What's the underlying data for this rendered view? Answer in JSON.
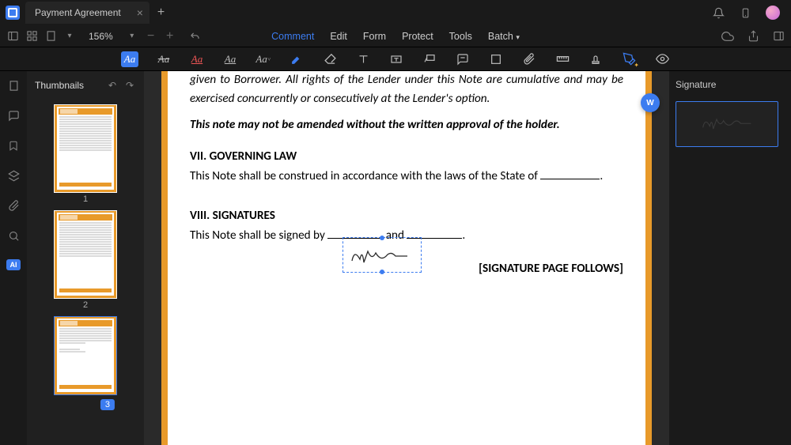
{
  "tab": {
    "title": "Payment Agreement"
  },
  "zoom": "156%",
  "menu": {
    "comment": "Comment",
    "edit": "Edit",
    "form": "Form",
    "protect": "Protect",
    "tools": "Tools",
    "batch": "Batch"
  },
  "thumbnails": {
    "title": "Thumbnails",
    "pages": [
      "1",
      "2",
      "3"
    ]
  },
  "doc": {
    "p1": "given to Borrower. All rights of the Lender under this Note are cumulative and may be exercised concurrently or consecutively at the Lender's option.",
    "p2": "This note may not be amended without the written approval of the holder.",
    "s7_title": "VII. GOVERNING LAW",
    "s7_body_a": "This Note shall be construed in accordance with the laws of the State of ",
    "s7_body_b": ".",
    "s8_title": "VIII. SIGNATURES",
    "s8_body_a": "This Note shall be signed by ",
    "s8_and": " and ",
    "s8_body_b": ".",
    "follows": "[SIGNATURE PAGE FOLLOWS]"
  },
  "right_panel": {
    "title": "Signature"
  },
  "ai_label": "AI",
  "floating": "W"
}
